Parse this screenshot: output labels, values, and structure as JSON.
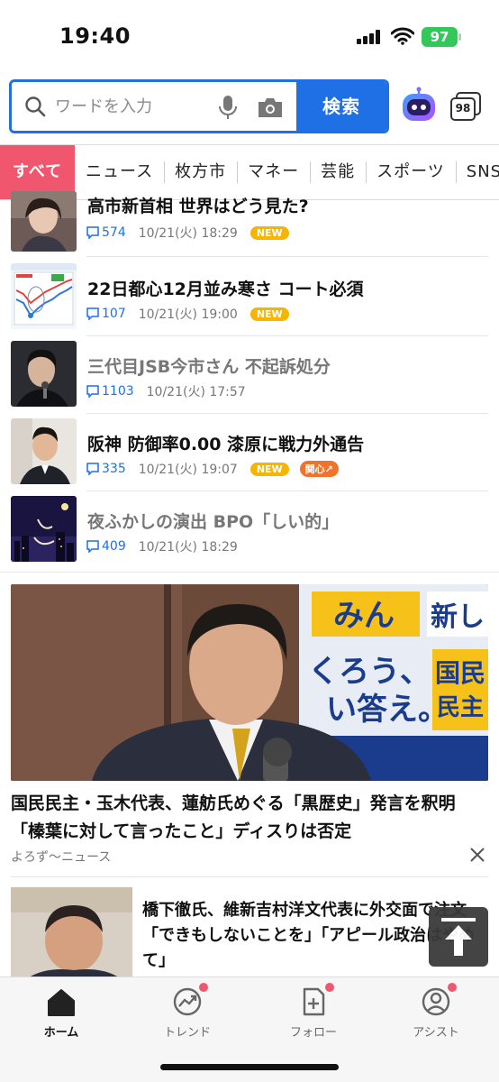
{
  "status": {
    "time": "19:40",
    "battery": "97"
  },
  "search": {
    "placeholder": "ワードを入力",
    "button": "検索",
    "tab_count": "98"
  },
  "categories": [
    "すべて",
    "ニュース",
    "枚方市",
    "マネー",
    "芸能",
    "スポーツ",
    "SNS"
  ],
  "news": [
    {
      "title": "高市新首相 世界はどう見た?",
      "comments": "574",
      "date": "10/21(火) 18:29",
      "badge": "NEW",
      "read": false
    },
    {
      "title": "22日都心12月並み寒さ コート必須",
      "comments": "107",
      "date": "10/21(火) 19:00",
      "badge": "NEW",
      "read": false
    },
    {
      "title": "三代目JSB今市さん 不起訴処分",
      "comments": "1103",
      "date": "10/21(火) 17:57",
      "badge": "",
      "read": true
    },
    {
      "title": "阪神 防御率0.00 漆原に戦力外通告",
      "comments": "335",
      "date": "10/21(火) 19:07",
      "badge": "NEW",
      "badge2": "関心",
      "read": false
    },
    {
      "title": "夜ふかしの演出 BPO「しい的」",
      "comments": "409",
      "date": "10/21(火) 18:29",
      "badge": "",
      "read": true
    }
  ],
  "feature": {
    "title": "国民民主・玉木代表、蓮舫氏めぐる「黒歴史」発言を釈明「榛葉に対して言ったこと」ディスりは否定",
    "source": "よろず〜ニュース",
    "banner_text": [
      "みん",
      "新し",
      "くろう、",
      "い答え。",
      "国民",
      "民主"
    ]
  },
  "article2": {
    "title": "橋下徹氏、維新吉村洋文代表に外交面で注文「できもしないことを」「アピール政治はやめて」"
  },
  "nav": [
    {
      "label": "ホーム",
      "icon": "home-icon"
    },
    {
      "label": "トレンド",
      "icon": "trend-icon"
    },
    {
      "label": "フォロー",
      "icon": "follow-icon"
    },
    {
      "label": "アシスト",
      "icon": "assist-icon"
    }
  ],
  "colors": {
    "accent": "#1f6fe5",
    "active_tab": "#f0566d",
    "new_badge": "#f7b500"
  }
}
